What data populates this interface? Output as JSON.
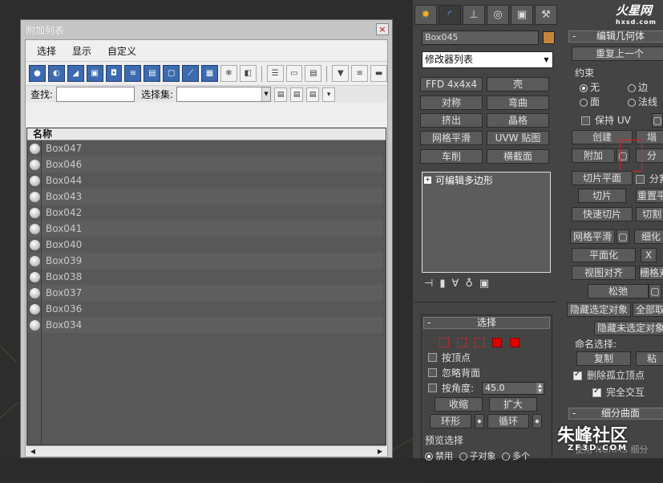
{
  "dialog": {
    "title": "附加列表",
    "close": "×",
    "menu": [
      "选择",
      "显示",
      "自定义"
    ],
    "find_label": "查找:",
    "selset_label": "选择集:",
    "column_header": "名称",
    "items": [
      "Box047",
      "Box046",
      "Box044",
      "Box043",
      "Box042",
      "Box041",
      "Box040",
      "Box039",
      "Box038",
      "Box037",
      "Box036",
      "Box034"
    ]
  },
  "panel": {
    "object_name": "Box045",
    "color": "#c8853a",
    "modifier_list": "修改器列表",
    "mod_buttons": [
      "FFD 4x4x4",
      "壳",
      "对称",
      "弯曲",
      "挤出",
      "晶格",
      "网格平滑",
      "UVW 贴图",
      "车削",
      "横截面"
    ],
    "stack_item": "可编辑多边形",
    "selection": {
      "title": "选择",
      "by_vertex": "按顶点",
      "ignore_backface": "忽略背面",
      "by_angle": "按角度:",
      "angle_value": "45.0",
      "shrink": "收缩",
      "grow": "扩大",
      "ring": "环形",
      "loop": "循环",
      "preview": "预览选择",
      "disabled": "禁用",
      "subobject": "子对象",
      "multi": "多个"
    },
    "edit_geometry": {
      "title": "编辑几何体",
      "repeat_last": "重复上一个",
      "constraints": "约束",
      "none": "无",
      "edge": "边",
      "face": "面",
      "normal": "法线",
      "preserve_uv": "保持 UV",
      "create": "创建",
      "collapse": "塌",
      "attach": "附加",
      "detach": "分",
      "slice_plane": "切片平面",
      "split": "分割",
      "slice": "切片",
      "reset": "重置平",
      "quickslice": "快速切片",
      "cut": "切割",
      "meshsmooth": "网格平滑",
      "tessellate": "细化",
      "planarize": "平面化",
      "x": "X",
      "view_align": "视图对齐",
      "grid_align": "栅格对",
      "relax": "松弛",
      "hide_selected": "隐藏选定对象",
      "unhide_all": "全部取",
      "hide_unselected": "隐藏未选定对象",
      "named_sel": "命名选择:",
      "copy": "复制",
      "paste": "粘",
      "delete_isolated": "删除孤立顶点",
      "full_interactivity": "完全交互"
    },
    "subdivision": {
      "title": "细分曲面",
      "nurms": "使用 NURMS 细分"
    }
  },
  "logo": {
    "main": "火星网",
    "sub": "hxsd.com"
  },
  "watermark": {
    "main": "朱峰社区",
    "sub": "ZF3D.COM"
  }
}
